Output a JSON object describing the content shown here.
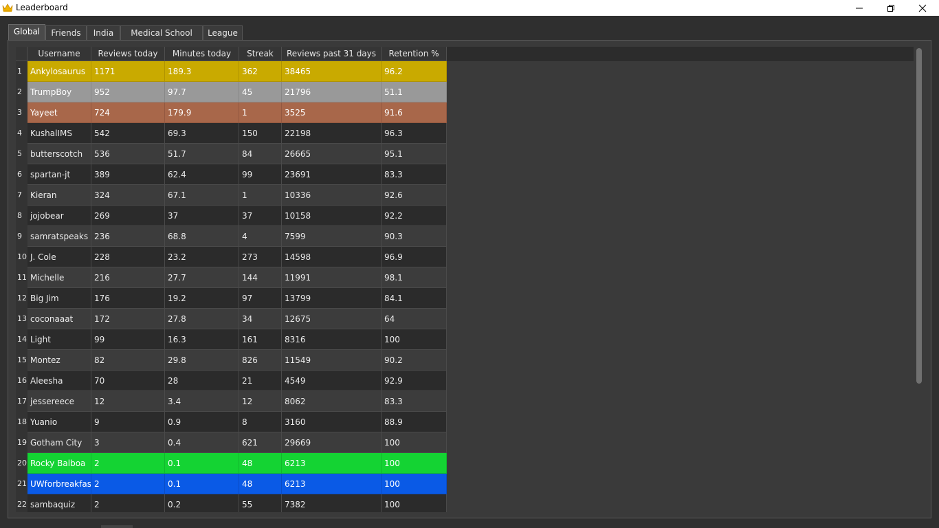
{
  "window": {
    "title": "Leaderboard",
    "icon": "crown-icon"
  },
  "tabs": [
    {
      "label": "Global",
      "active": true
    },
    {
      "label": "Friends",
      "active": false
    },
    {
      "label": "India",
      "active": false
    },
    {
      "label": "Medical School Anki",
      "active": false
    },
    {
      "label": "League",
      "active": false
    }
  ],
  "columns": [
    "Username",
    "Reviews today",
    "Minutes today",
    "Streak",
    "Reviews past 31 days",
    "Retention %"
  ],
  "colors": {
    "gold": "#c9aa00",
    "silver": "#999999",
    "bronze": "#a8674a",
    "green": "#14d333",
    "blue": "#0a5ae6"
  },
  "rows": [
    {
      "rank": "1",
      "username": "Ankylosaurus",
      "reviews_today": "1171",
      "minutes_today": "189.3",
      "streak": "362",
      "reviews_31": "38465",
      "retention": "96.2",
      "highlight": "gold"
    },
    {
      "rank": "2",
      "username": "TrumpBoy",
      "reviews_today": "952",
      "minutes_today": "97.7",
      "streak": "45",
      "reviews_31": "21796",
      "retention": "51.1",
      "highlight": "silver"
    },
    {
      "rank": "3",
      "username": "Yayeet",
      "reviews_today": "724",
      "minutes_today": "179.9",
      "streak": "1",
      "reviews_31": "3525",
      "retention": "91.6",
      "highlight": "bronze"
    },
    {
      "rank": "4",
      "username": "KushalIMS",
      "reviews_today": "542",
      "minutes_today": "69.3",
      "streak": "150",
      "reviews_31": "22198",
      "retention": "96.3",
      "highlight": ""
    },
    {
      "rank": "5",
      "username": " butterscotch",
      "reviews_today": "536",
      "minutes_today": "51.7",
      "streak": "84",
      "reviews_31": "26665",
      "retention": "95.1",
      "highlight": ""
    },
    {
      "rank": "6",
      "username": "spartan-jt",
      "reviews_today": "389",
      "minutes_today": "62.4",
      "streak": "99",
      "reviews_31": "23691",
      "retention": "83.3",
      "highlight": ""
    },
    {
      "rank": "7",
      "username": "Kieran",
      "reviews_today": "324",
      "minutes_today": "67.1",
      "streak": "1",
      "reviews_31": "10336",
      "retention": "92.6",
      "highlight": ""
    },
    {
      "rank": "8",
      "username": "jojobear",
      "reviews_today": "269",
      "minutes_today": "37",
      "streak": "37",
      "reviews_31": "10158",
      "retention": "92.2",
      "highlight": ""
    },
    {
      "rank": "9",
      "username": "samratspeaks",
      "reviews_today": "236",
      "minutes_today": "68.8",
      "streak": "4",
      "reviews_31": "7599",
      "retention": "90.3",
      "highlight": ""
    },
    {
      "rank": "10",
      "username": "J. Cole",
      "reviews_today": "228",
      "minutes_today": "23.2",
      "streak": "273",
      "reviews_31": "14598",
      "retention": "96.9",
      "highlight": ""
    },
    {
      "rank": "11",
      "username": "Michelle",
      "reviews_today": "216",
      "minutes_today": "27.7",
      "streak": "144",
      "reviews_31": "11991",
      "retention": "98.1",
      "highlight": ""
    },
    {
      "rank": "12",
      "username": "Big Jim",
      "reviews_today": "176",
      "minutes_today": "19.2",
      "streak": "97",
      "reviews_31": "13799",
      "retention": "84.1",
      "highlight": ""
    },
    {
      "rank": "13",
      "username": "coconaaat",
      "reviews_today": "172",
      "minutes_today": "27.8",
      "streak": "34",
      "reviews_31": "12675",
      "retention": "64",
      "highlight": ""
    },
    {
      "rank": "14",
      "username": "Light",
      "reviews_today": "99",
      "minutes_today": "16.3",
      "streak": "161",
      "reviews_31": "8316",
      "retention": "100",
      "highlight": ""
    },
    {
      "rank": "15",
      "username": "Montez",
      "reviews_today": "82",
      "minutes_today": "29.8",
      "streak": "826",
      "reviews_31": "11549",
      "retention": "90.2",
      "highlight": ""
    },
    {
      "rank": "16",
      "username": "Aleesha",
      "reviews_today": "70",
      "minutes_today": "28",
      "streak": "21",
      "reviews_31": "4549",
      "retention": "92.9",
      "highlight": ""
    },
    {
      "rank": "17",
      "username": "jessereece",
      "reviews_today": "12",
      "minutes_today": "3.4",
      "streak": "12",
      "reviews_31": "8062",
      "retention": "83.3",
      "highlight": ""
    },
    {
      "rank": "18",
      "username": "Yuanio",
      "reviews_today": "9",
      "minutes_today": "0.9",
      "streak": "8",
      "reviews_31": "3160",
      "retention": "88.9",
      "highlight": ""
    },
    {
      "rank": "19",
      "username": "Gotham City",
      "reviews_today": "3",
      "minutes_today": "0.4",
      "streak": "621",
      "reviews_31": "29669",
      "retention": "100",
      "highlight": ""
    },
    {
      "rank": "20",
      "username": "Rocky Balboa",
      "reviews_today": "2",
      "minutes_today": "0.1",
      "streak": "48",
      "reviews_31": "6213",
      "retention": "100",
      "highlight": "green"
    },
    {
      "rank": "21",
      "username": "UWforbreakfast",
      "reviews_today": "2",
      "minutes_today": "0.1",
      "streak": "48",
      "reviews_31": "6213",
      "retention": "100",
      "highlight": "blue"
    },
    {
      "rank": "22",
      "username": "sambaquiz",
      "reviews_today": "2",
      "minutes_today": "0.2",
      "streak": "55",
      "reviews_31": "7382",
      "retention": "100",
      "highlight": ""
    }
  ]
}
